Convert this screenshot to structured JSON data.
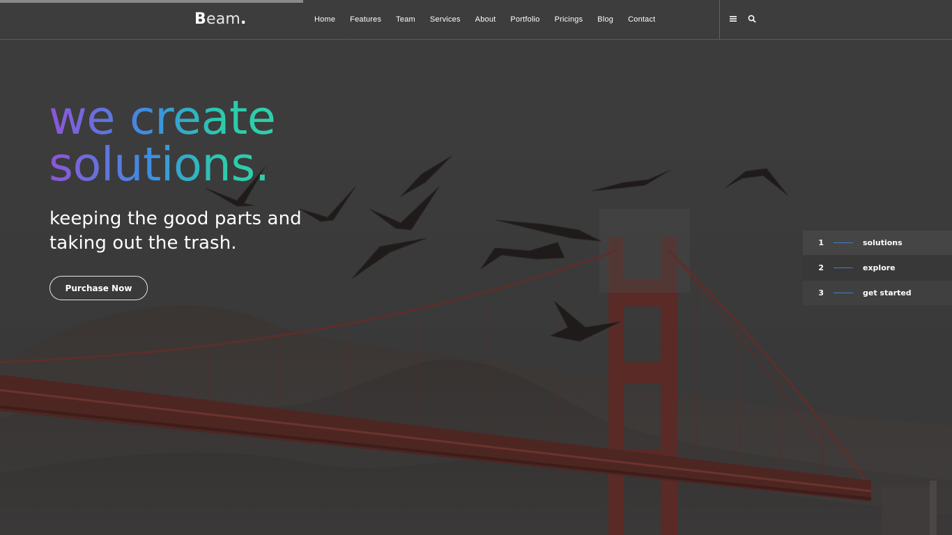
{
  "brand": {
    "logo_bold": "B",
    "logo_rest": "eam",
    "logo_dot": "."
  },
  "nav": {
    "items": [
      "Home",
      "Features",
      "Team",
      "Services",
      "About",
      "Portfolio",
      "Pricings",
      "Blog",
      "Contact"
    ]
  },
  "header_icons": [
    "menu-icon",
    "search-icon"
  ],
  "hero": {
    "headline_line1": "we create",
    "headline_line2": "solutions.",
    "subline_line1": "keeping the good parts and",
    "subline_line2": "taking out the trash.",
    "cta_label": "Purchase Now"
  },
  "slide_nav": {
    "items": [
      {
        "number": "1",
        "label": "solutions"
      },
      {
        "number": "2",
        "label": "explore"
      },
      {
        "number": "3",
        "label": "get started"
      }
    ]
  },
  "colors": {
    "gradient_start": "#8f55d8",
    "gradient_mid": "#3b8fe2",
    "gradient_end": "#2ed1a8",
    "background": "#3b3b3b",
    "bridge": "#5a2a26",
    "accent_line": "#3f7fd0"
  }
}
